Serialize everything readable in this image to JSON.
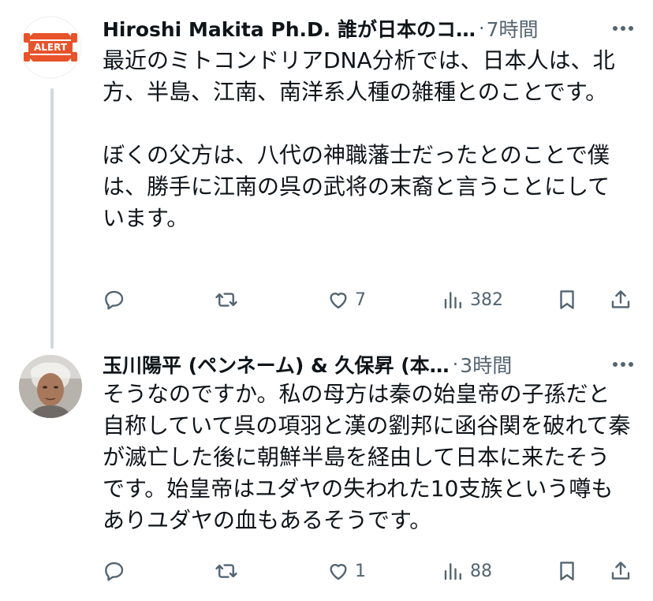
{
  "tweets": [
    {
      "author": "Hiroshi Makita Ph.D. 誰が日本のコ…",
      "separator": "·",
      "time": "7時間",
      "avatar_text": "ALERT",
      "paragraphs": [
        "最近のミトコンドリアDNA分析では、日本人は、北方、半島、江南、南洋系人種の雑種とのことです。",
        "ぼくの父方は、八代の神職藩士だったとのことで僕は、勝手に江南の呉の武将の末裔と言うことにしています。"
      ],
      "replies": "",
      "retweets": "",
      "likes": "7",
      "views": "382"
    },
    {
      "author": "玉川陽平 (ペンネーム) & 久保昇 (本…",
      "separator": "·",
      "time": "3時間",
      "paragraphs": [
        "そうなのですか。私の母方は秦の始皇帝の子孫だと自称していて呉の項羽と漢の劉邦に函谷関を破れて秦が滅亡した後に朝鮮半島を経由して日本に来たそうです。始皇帝はユダヤの失われた10支族という噂もありユダヤの血もあるそうです。"
      ],
      "replies": "",
      "retweets": "",
      "likes": "1",
      "views": "88"
    }
  ],
  "icons": {
    "more": "more-dots-icon",
    "reply": "reply-bubble-icon",
    "retweet": "retweet-arrows-icon",
    "like": "heart-icon",
    "views": "views-bars-icon",
    "bookmark": "bookmark-icon",
    "share": "share-upload-icon"
  },
  "colors": {
    "text": "#0f1419",
    "secondary": "#536471",
    "thread_line": "#cfd9de",
    "alert_orange": "#e8532b"
  }
}
